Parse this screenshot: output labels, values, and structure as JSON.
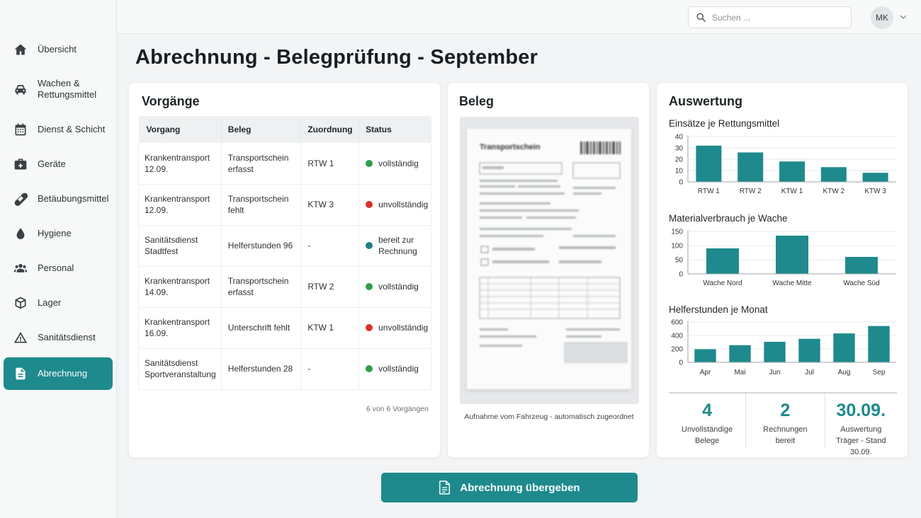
{
  "nav": {
    "items": [
      {
        "label": "Übersicht",
        "icon": "home-icon"
      },
      {
        "label": "Wachen & Rettungsmittel",
        "icon": "ambulance-car-icon"
      },
      {
        "label": "Dienst & Schicht",
        "icon": "calendar-icon"
      },
      {
        "label": "Geräte",
        "icon": "medical-bag-icon"
      },
      {
        "label": "Betäubungsmittel",
        "icon": "pill-icon"
      },
      {
        "label": "Hygiene",
        "icon": "droplet-icon"
      },
      {
        "label": "Personal",
        "icon": "people-icon"
      },
      {
        "label": "Lager",
        "icon": "box-icon"
      },
      {
        "label": "Sanitätsdienst",
        "icon": "warning-triangle-icon"
      },
      {
        "label": "Abrechnung",
        "icon": "document-icon",
        "active": true
      }
    ]
  },
  "topbar": {
    "search_placeholder": "Suchen ...",
    "avatar_initials": "MK"
  },
  "page": {
    "title": "Abrechnung - Belegprüfung - September"
  },
  "vorgaenge": {
    "title": "Vorgänge",
    "columns": [
      "Vorgang",
      "Beleg",
      "Zuordnung",
      "Status"
    ],
    "rows": [
      {
        "vorgang": "Krankentransport 12.09.",
        "beleg": "Transportschein erfasst",
        "zuordnung": "RTW 1",
        "status": "vollständig",
        "status_color": "#2e9e4a"
      },
      {
        "vorgang": "Krankentransport 12.09.",
        "beleg": "Transportschein fehlt",
        "zuordnung": "KTW 3",
        "status": "unvollständig",
        "status_color": "#d8312b"
      },
      {
        "vorgang": "Sanitätsdienst Stadtfest",
        "beleg": "Helferstunden 96",
        "zuordnung": "-",
        "status": "bereit zur Rechnung",
        "status_color": "#1e7f88"
      },
      {
        "vorgang": "Krankentransport 14.09.",
        "beleg": "Transportschein erfasst",
        "zuordnung": "RTW 2",
        "status": "vollständig",
        "status_color": "#2e9e4a"
      },
      {
        "vorgang": "Krankentransport 16.09.",
        "beleg": "Unterschrift fehlt",
        "zuordnung": "KTW 1",
        "status": "unvollständig",
        "status_color": "#d8312b"
      },
      {
        "vorgang": "Sanitätsdienst Sportveranstaltung",
        "beleg": "Helferstunden 28",
        "zuordnung": "-",
        "status": "vollständig",
        "status_color": "#2e9e4a"
      }
    ],
    "footer": "6 von 6 Vorgängen"
  },
  "beleg": {
    "title": "Beleg",
    "document_title": "Transportschein",
    "caption": "Aufnahme vom Fahrzeug - automatisch zugeordnet"
  },
  "auswertung": {
    "title": "Auswertung",
    "stats": [
      {
        "value": "4",
        "label": "Unvollständige Belege"
      },
      {
        "value": "2",
        "label": "Rechnungen bereit"
      },
      {
        "value": "30.09.",
        "label": "Auswertung Träger - Stand 30.09."
      }
    ]
  },
  "chart_data": [
    {
      "type": "bar",
      "title": "Einsätze je Rettungsmittel",
      "categories": [
        "RTW 1",
        "RTW 2",
        "KTW 1",
        "KTW 2",
        "KTW 3"
      ],
      "values": [
        32,
        26,
        18,
        13,
        8
      ],
      "yticks": [
        0,
        10,
        20,
        30,
        40
      ],
      "ylim": [
        0,
        40
      ],
      "color": "#1e8a8d"
    },
    {
      "type": "bar",
      "title": "Materialverbrauch je Wache",
      "categories": [
        "Wache Nord",
        "Wache Mitte",
        "Wache Süd"
      ],
      "values": [
        90,
        135,
        60
      ],
      "yticks": [
        0,
        50,
        100,
        150
      ],
      "ylim": [
        0,
        150
      ],
      "color": "#1e8a8d"
    },
    {
      "type": "bar",
      "title": "Helferstunden je Monat",
      "categories": [
        "Apr",
        "Mai",
        "Jun",
        "Jul",
        "Aug",
        "Sep"
      ],
      "values": [
        195,
        255,
        305,
        350,
        430,
        540
      ],
      "yticks": [
        0,
        200,
        400,
        600
      ],
      "ylim": [
        0,
        600
      ],
      "color": "#1e8a8d"
    }
  ],
  "actions": {
    "submit_label": "Abrechnung übergeben"
  }
}
